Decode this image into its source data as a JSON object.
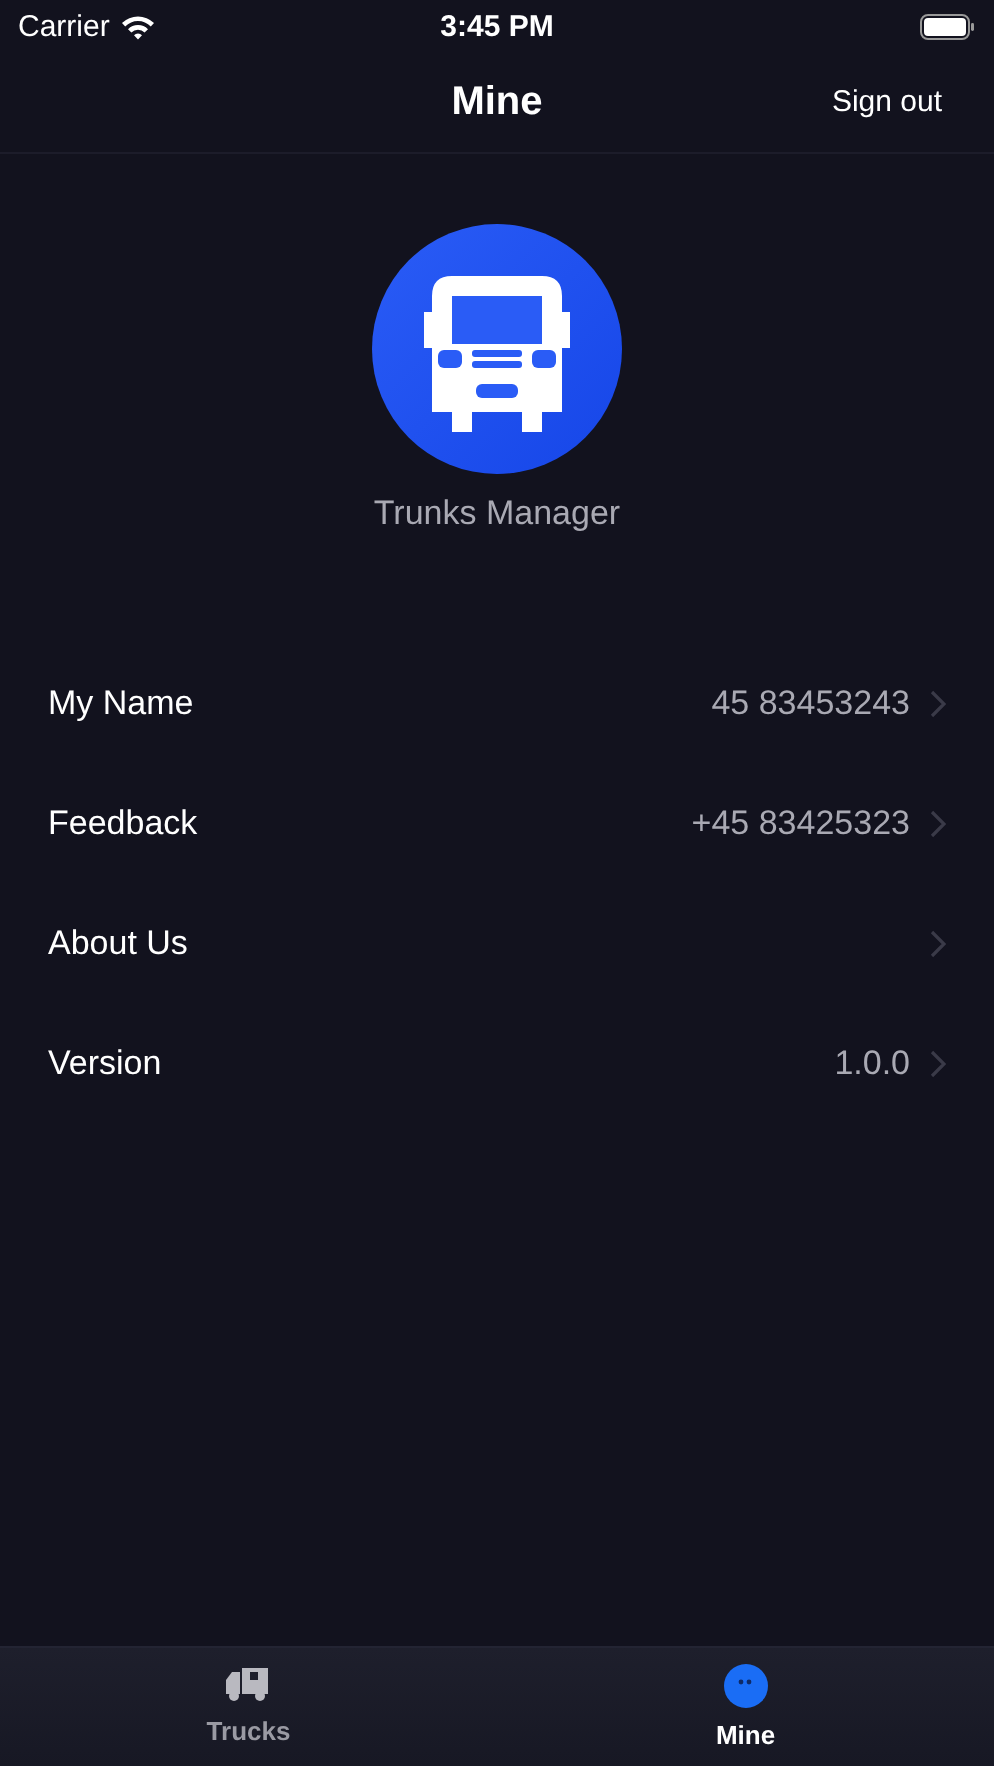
{
  "status_bar": {
    "carrier": "Carrier",
    "time": "3:45 PM"
  },
  "nav": {
    "title": "Mine",
    "action": "Sign out"
  },
  "profile": {
    "name": "Trunks Manager"
  },
  "rows": [
    {
      "label": "My Name",
      "value": "45 83453243"
    },
    {
      "label": "Feedback",
      "value": "+45 83425323"
    },
    {
      "label": "About Us"
    },
    {
      "label": "Version",
      "value": "1.0.0"
    }
  ],
  "tabs": [
    {
      "label": "Trucks",
      "kind": "truck",
      "selected": false
    },
    {
      "label": "Mine",
      "kind": "person",
      "selected": true
    }
  ]
}
